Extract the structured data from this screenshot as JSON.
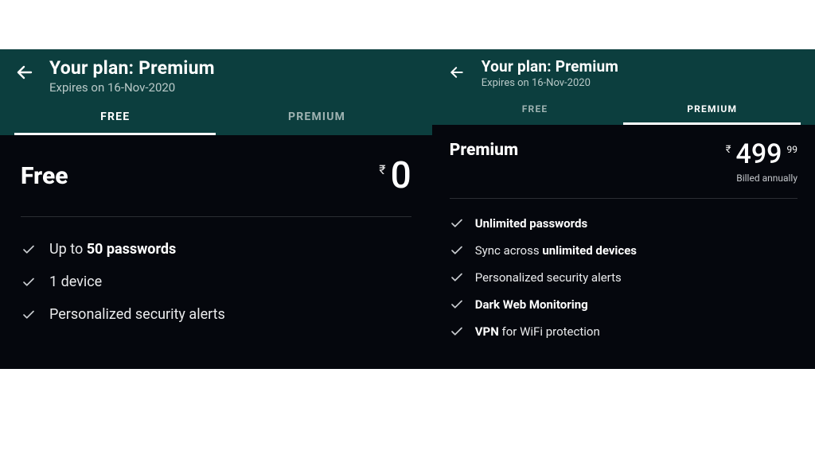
{
  "left": {
    "header": {
      "title": "Your plan: Premium",
      "subtitle": "Expires on 16-Nov-2020"
    },
    "tabs": {
      "free": "FREE",
      "premium": "PREMIUM",
      "active": "free"
    },
    "plan": {
      "name": "Free",
      "currency": "₹",
      "amount": "0",
      "cents": "",
      "billing_note": ""
    },
    "features": [
      {
        "html": "Up to <b>50 passwords</b>"
      },
      {
        "html": "1 device"
      },
      {
        "html": "Personalized security alerts"
      }
    ]
  },
  "right": {
    "header": {
      "title": "Your plan: Premium",
      "subtitle": "Expires on 16-Nov-2020"
    },
    "tabs": {
      "free": "FREE",
      "premium": "PREMIUM",
      "active": "premium"
    },
    "plan": {
      "name": "Premium",
      "currency": "₹",
      "amount": "499",
      "cents": "99",
      "billing_note": "Billed annually"
    },
    "features": [
      {
        "html": "<b>Unlimited passwords</b>"
      },
      {
        "html": "Sync across <b>unlimited devices</b>"
      },
      {
        "html": "Personalized security alerts"
      },
      {
        "html": "<b>Dark Web Monitoring</b>"
      },
      {
        "html": "<b>VPN</b> for WiFi protection"
      }
    ]
  }
}
